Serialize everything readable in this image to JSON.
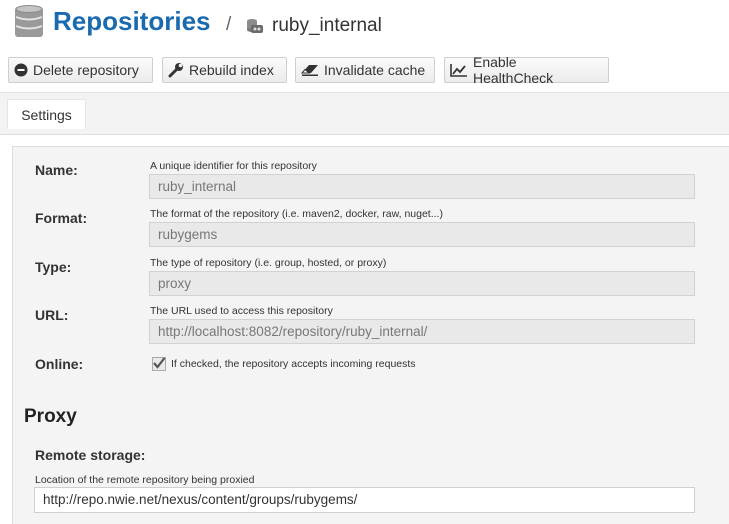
{
  "header": {
    "title": "Repositories",
    "separator": "/",
    "repo_name": "ruby_internal"
  },
  "toolbar": {
    "delete": "Delete repository",
    "rebuild": "Rebuild index",
    "invalidate": "Invalidate cache",
    "healthcheck": "Enable HealthCheck"
  },
  "tabs": {
    "settings": "Settings"
  },
  "form": {
    "name": {
      "label": "Name:",
      "help": "A unique identifier for this repository",
      "value": "ruby_internal"
    },
    "format": {
      "label": "Format:",
      "help": "The format of the repository (i.e. maven2, docker, raw, nuget...)",
      "value": "rubygems"
    },
    "type": {
      "label": "Type:",
      "help": "The type of repository (i.e. group, hosted, or proxy)",
      "value": "proxy"
    },
    "url": {
      "label": "URL:",
      "help": "The URL used to access this repository",
      "value": "http://localhost:8082/repository/ruby_internal/"
    },
    "online": {
      "label": "Online:",
      "help": "If checked, the repository accepts incoming requests",
      "checked": true
    }
  },
  "proxy": {
    "title": "Proxy",
    "remote_label": "Remote storage:",
    "remote_help": "Location of the remote repository being proxied",
    "remote_value": "http://repo.nwie.net/nexus/content/groups/rubygems/"
  },
  "icons": {
    "header": "database-icon",
    "repo": "repository-icon",
    "delete": "minus-circle-icon",
    "rebuild": "wrench-icon",
    "invalidate": "eraser-icon",
    "healthcheck": "line-chart-icon",
    "online": "checkmark-icon"
  },
  "colors": {
    "title": "#1a6ab0",
    "panel": "#f4f4f4",
    "readonly_field": "#e9e9e9"
  }
}
